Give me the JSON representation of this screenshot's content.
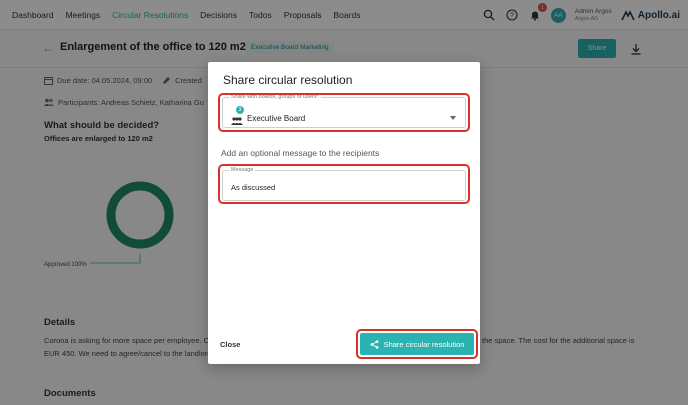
{
  "nav": {
    "items": [
      {
        "label": "Dashboard",
        "active": false
      },
      {
        "label": "Meetings",
        "active": false
      },
      {
        "label": "Circular Resolutions",
        "active": true
      },
      {
        "label": "Decisions",
        "active": false
      },
      {
        "label": "Todos",
        "active": false
      },
      {
        "label": "Proposals",
        "active": false
      },
      {
        "label": "Boards",
        "active": false
      }
    ],
    "notification_count": "1",
    "avatar_initials": "AA",
    "user_name": "Admin Argos",
    "user_org": "Argos AG",
    "brand": "Apollo.ai"
  },
  "page": {
    "title": "Enlargement of the office to 120 m2",
    "tag": "Executive Board Marketing",
    "share_label": "Share",
    "due_date": "Due date: 04.05.2024, 09:00",
    "created": "Created",
    "participants": "Participants: Andreas Schietz, Katharina Gu",
    "question_heading": "What should be decided?",
    "question_text": "Offices are enlarged to 120 m2",
    "chart_label": "Approved 100%",
    "details_heading": "Details",
    "details_text_1": "Corona is asking for more space per employee. Cr",
    "details_text_1b": "the space. The cost for the additional space is",
    "details_text_2": "EUR 450. We need to agree/cancel to the landlord",
    "documents_heading": "Documents"
  },
  "chart_data": {
    "type": "pie",
    "categories": [
      "Approved"
    ],
    "values": [
      100
    ],
    "title": "",
    "legend": "Approved 100%"
  },
  "modal": {
    "title": "Share circular resolution",
    "share_field_label": "Share with boards, groups or users*",
    "selected_value": "Executive Board",
    "member_count": "3",
    "optional_label": "Add an optional message to the recipients",
    "message_field_label": "Message",
    "message_value": "As discussed",
    "close_label": "Close",
    "share_button_label": "Share circular resolution"
  },
  "colors": {
    "accent": "#2bb3b1",
    "highlight": "#d9302c",
    "donut": "#1f8a6a"
  }
}
